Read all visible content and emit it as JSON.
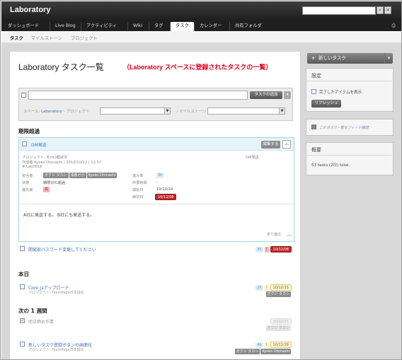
{
  "app": {
    "title": "Laboratory"
  },
  "nav": {
    "items": [
      "ダッシュボード",
      "Live Blog",
      "アクティビティ",
      "Wiki",
      "タグ",
      "タスク",
      "カレンダー",
      "共有フォルダ"
    ],
    "active": "タスク"
  },
  "subnav": {
    "items": [
      "タスク",
      "マイルストーン",
      "プロジェクト"
    ]
  },
  "page": {
    "title": "Laboratory タスク一覧",
    "subtitle": "（Laboratory スペースに登録されたタスクの一覧）"
  },
  "add_task": {
    "button": "タスクの追加",
    "space_label": "スペース:",
    "space_value": "Laboratory",
    "project_label": "プロジェクト",
    "milestone_label": "マイルストーン"
  },
  "sections": {
    "overdue": "期限超過",
    "today": "本日",
    "next_week": "次の 1 週間"
  },
  "open_task": {
    "title": "DM発送",
    "edit_button": "編集する",
    "project": "プロジェクト: 外(m)都就労",
    "created": "作成者 Kyoko Otonashi | 2010/10/12 | 12:57",
    "id": "# Lab0016",
    "right_title": "DM発送",
    "fields": {
      "assignee_label": "担当者",
      "assignees": [
        "オクジ タカシ",
        "浅番ガガ",
        "Kyoko Otonashi"
      ],
      "status_label": "状態",
      "status_value": "期限切れ超過",
      "priority_label": "優先度",
      "priority_value": "高",
      "progress_label": "進み率",
      "progress_value": "3h",
      "estimate_label": "所要時間",
      "estimate_value": "-",
      "start_label": "開始日",
      "start_value": "10/10/24",
      "due_label": "締切日",
      "due_value": "10/12/08"
    },
    "body": "A社に発送する。 B社にも発送する。",
    "collapse": "折り畳む"
  },
  "tasks_overdue": [
    {
      "title": "開発部パスワード変更してください",
      "hours": "3h",
      "prio": "!",
      "due": "10/12/08"
    }
  ],
  "tasks_today": [
    {
      "title": "Core_jsアップロード",
      "sub": "プロジェクト: TeamPage日本語化",
      "hours": "2h",
      "prio": "!",
      "due": "10/12/15",
      "owner": "オクジ タカシ"
    }
  ],
  "tasks_week": [
    {
      "title": "明日締め作業",
      "due": "10/12/21",
      "owner": "オクジ タカシ",
      "done": true
    },
    {
      "title": "新しいタスク登録ボタンの画面化",
      "sub": "プロジェクト: TeamPage日本語化",
      "hours": "4h",
      "prio": "!",
      "due": "10/12/28",
      "owners": [
        "オクジ タカシ",
        "Kyoko Otonashi"
      ]
    }
  ],
  "sidebar": {
    "new_task": "新しいタスク",
    "settings_title": "設定",
    "show_completed": "完了したアイテムを表示",
    "refresh": "リフレッシュ",
    "feed_label": "このタスク一覧をフィード購読",
    "summary_title": "概要",
    "summary_text": "53 tasks (2日) total."
  },
  "colors": {
    "accent": "#e0001a",
    "link": "#3b6fb6",
    "overdue": "#c0282c"
  }
}
